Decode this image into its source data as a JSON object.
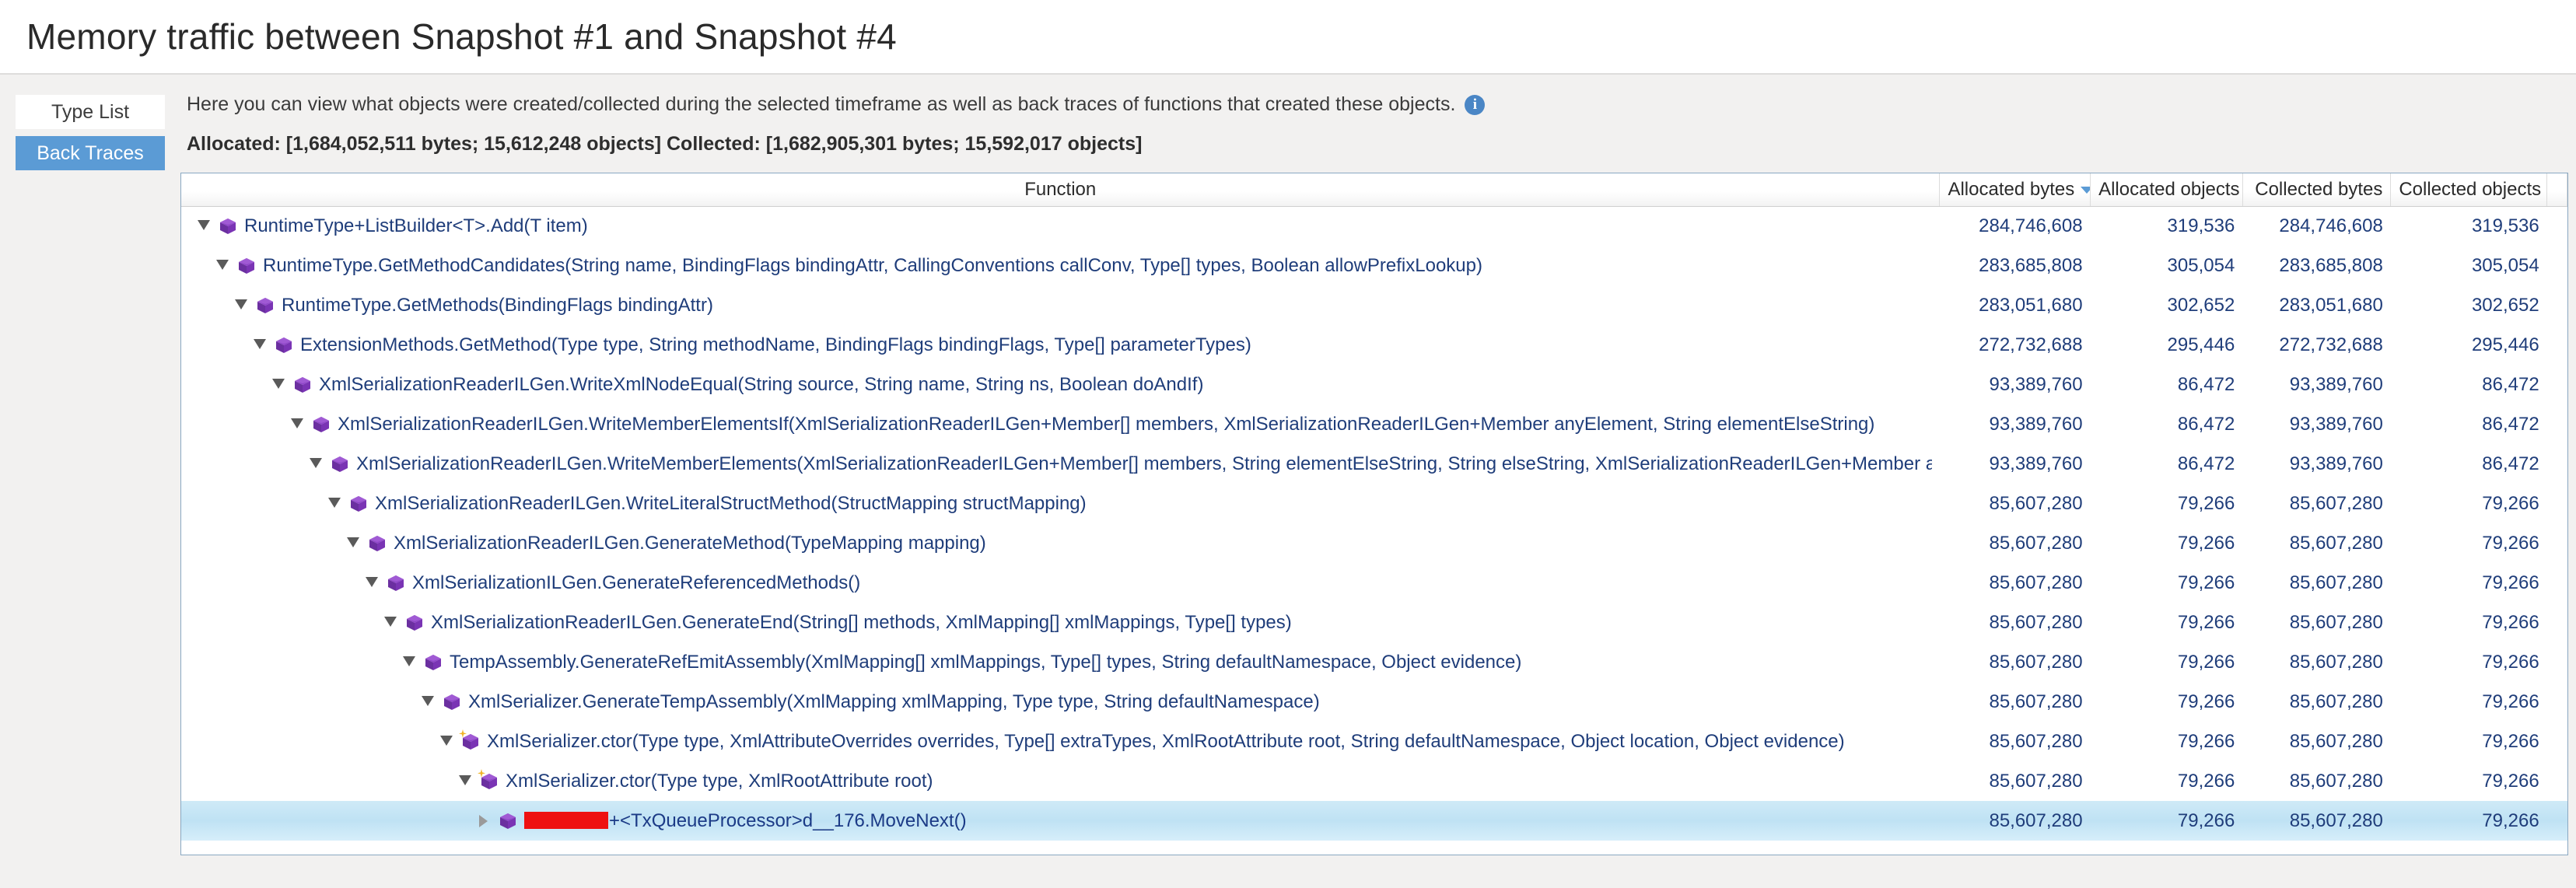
{
  "header": {
    "title": "Memory traffic between Snapshot #1 and Snapshot #4"
  },
  "sidebar": {
    "items": [
      {
        "label": "Type List",
        "active": false
      },
      {
        "label": "Back Traces",
        "active": true
      }
    ]
  },
  "main": {
    "info_text": "Here you can view what objects were created/collected during the selected timeframe as well as back traces of functions that created these objects.",
    "info_icon": "info-icon",
    "stats_text": "Allocated: [1,684,052,511 bytes; 15,612,248 objects] Collected: [1,682,905,301 bytes; 15,592,017 objects]"
  },
  "grid": {
    "columns": [
      {
        "label": "Function",
        "align": "center",
        "sorted": false
      },
      {
        "label": "Allocated bytes",
        "align": "right",
        "sorted": true,
        "sort_dir": "desc"
      },
      {
        "label": "Allocated objects",
        "align": "right",
        "sorted": false
      },
      {
        "label": "Collected bytes",
        "align": "right",
        "sorted": false
      },
      {
        "label": "Collected objects",
        "align": "right",
        "sorted": false
      }
    ],
    "rows": [
      {
        "depth": 0,
        "twisty": "expanded",
        "icon": "method-icon",
        "function": "RuntimeType+ListBuilder<T>.Add(T item)",
        "allocated_bytes": "284,746,608",
        "allocated_objects": "319,536",
        "collected_bytes": "284,746,608",
        "collected_objects": "319,536",
        "selected": false,
        "redacted": false
      },
      {
        "depth": 1,
        "twisty": "expanded",
        "icon": "method-icon",
        "function": "RuntimeType.GetMethodCandidates(String name, BindingFlags bindingAttr, CallingConventions callConv, Type[] types, Boolean allowPrefixLookup)",
        "allocated_bytes": "283,685,808",
        "allocated_objects": "305,054",
        "collected_bytes": "283,685,808",
        "collected_objects": "305,054",
        "selected": false,
        "redacted": false
      },
      {
        "depth": 2,
        "twisty": "expanded",
        "icon": "method-icon",
        "function": "RuntimeType.GetMethods(BindingFlags bindingAttr)",
        "allocated_bytes": "283,051,680",
        "allocated_objects": "302,652",
        "collected_bytes": "283,051,680",
        "collected_objects": "302,652",
        "selected": false,
        "redacted": false
      },
      {
        "depth": 3,
        "twisty": "expanded",
        "icon": "method-icon",
        "function": "ExtensionMethods.GetMethod(Type type, String methodName, BindingFlags bindingFlags, Type[] parameterTypes)",
        "allocated_bytes": "272,732,688",
        "allocated_objects": "295,446",
        "collected_bytes": "272,732,688",
        "collected_objects": "295,446",
        "selected": false,
        "redacted": false
      },
      {
        "depth": 4,
        "twisty": "expanded",
        "icon": "method-icon",
        "function": "XmlSerializationReaderILGen.WriteXmlNodeEqual(String source, String name, String ns, Boolean doAndIf)",
        "allocated_bytes": "93,389,760",
        "allocated_objects": "86,472",
        "collected_bytes": "93,389,760",
        "collected_objects": "86,472",
        "selected": false,
        "redacted": false
      },
      {
        "depth": 5,
        "twisty": "expanded",
        "icon": "method-icon",
        "function": "XmlSerializationReaderILGen.WriteMemberElementsIf(XmlSerializationReaderILGen+Member[] members, XmlSerializationReaderILGen+Member anyElement, String elementElseString)",
        "allocated_bytes": "93,389,760",
        "allocated_objects": "86,472",
        "collected_bytes": "93,389,760",
        "collected_objects": "86,472",
        "selected": false,
        "redacted": false
      },
      {
        "depth": 6,
        "twisty": "expanded",
        "icon": "method-icon",
        "function": "XmlSerializationReaderILGen.WriteMemberElements(XmlSerializationReaderILGen+Member[] members, String elementElseString, String elseString, XmlSerializationReaderILGen+Member anyEle",
        "allocated_bytes": "93,389,760",
        "allocated_objects": "86,472",
        "collected_bytes": "93,389,760",
        "collected_objects": "86,472",
        "selected": false,
        "redacted": false
      },
      {
        "depth": 7,
        "twisty": "expanded",
        "icon": "method-icon",
        "function": "XmlSerializationReaderILGen.WriteLiteralStructMethod(StructMapping structMapping)",
        "allocated_bytes": "85,607,280",
        "allocated_objects": "79,266",
        "collected_bytes": "85,607,280",
        "collected_objects": "79,266",
        "selected": false,
        "redacted": false
      },
      {
        "depth": 8,
        "twisty": "expanded",
        "icon": "method-icon",
        "function": "XmlSerializationReaderILGen.GenerateMethod(TypeMapping mapping)",
        "allocated_bytes": "85,607,280",
        "allocated_objects": "79,266",
        "collected_bytes": "85,607,280",
        "collected_objects": "79,266",
        "selected": false,
        "redacted": false
      },
      {
        "depth": 9,
        "twisty": "expanded",
        "icon": "method-icon",
        "function": "XmlSerializationILGen.GenerateReferencedMethods()",
        "allocated_bytes": "85,607,280",
        "allocated_objects": "79,266",
        "collected_bytes": "85,607,280",
        "collected_objects": "79,266",
        "selected": false,
        "redacted": false
      },
      {
        "depth": 10,
        "twisty": "expanded",
        "icon": "method-icon",
        "function": "XmlSerializationReaderILGen.GenerateEnd(String[] methods, XmlMapping[] xmlMappings, Type[] types)",
        "allocated_bytes": "85,607,280",
        "allocated_objects": "79,266",
        "collected_bytes": "85,607,280",
        "collected_objects": "79,266",
        "selected": false,
        "redacted": false
      },
      {
        "depth": 11,
        "twisty": "expanded",
        "icon": "method-icon",
        "function": "TempAssembly.GenerateRefEmitAssembly(XmlMapping[] xmlMappings, Type[] types, String defaultNamespace, Object evidence)",
        "allocated_bytes": "85,607,280",
        "allocated_objects": "79,266",
        "collected_bytes": "85,607,280",
        "collected_objects": "79,266",
        "selected": false,
        "redacted": false
      },
      {
        "depth": 12,
        "twisty": "expanded",
        "icon": "method-icon",
        "function": "XmlSerializer.GenerateTempAssembly(XmlMapping xmlMapping, Type type, String defaultNamespace)",
        "allocated_bytes": "85,607,280",
        "allocated_objects": "79,266",
        "collected_bytes": "85,607,280",
        "collected_objects": "79,266",
        "selected": false,
        "redacted": false
      },
      {
        "depth": 13,
        "twisty": "expanded",
        "icon": "constructor-icon",
        "function": "XmlSerializer.ctor(Type type, XmlAttributeOverrides overrides, Type[] extraTypes, XmlRootAttribute root, String defaultNamespace, Object location, Object evidence)",
        "allocated_bytes": "85,607,280",
        "allocated_objects": "79,266",
        "collected_bytes": "85,607,280",
        "collected_objects": "79,266",
        "selected": false,
        "redacted": false
      },
      {
        "depth": 14,
        "twisty": "expanded",
        "icon": "constructor-icon",
        "function": "XmlSerializer.ctor(Type type, XmlRootAttribute root)",
        "allocated_bytes": "85,607,280",
        "allocated_objects": "79,266",
        "collected_bytes": "85,607,280",
        "collected_objects": "79,266",
        "selected": false,
        "redacted": false
      },
      {
        "depth": 15,
        "twisty": "collapsed",
        "icon": "method-icon",
        "function": "+<TxQueueProcessor>d__176.MoveNext()",
        "allocated_bytes": "85,607,280",
        "allocated_objects": "79,266",
        "collected_bytes": "85,607,280",
        "collected_objects": "79,266",
        "selected": true,
        "redacted": true
      }
    ]
  }
}
